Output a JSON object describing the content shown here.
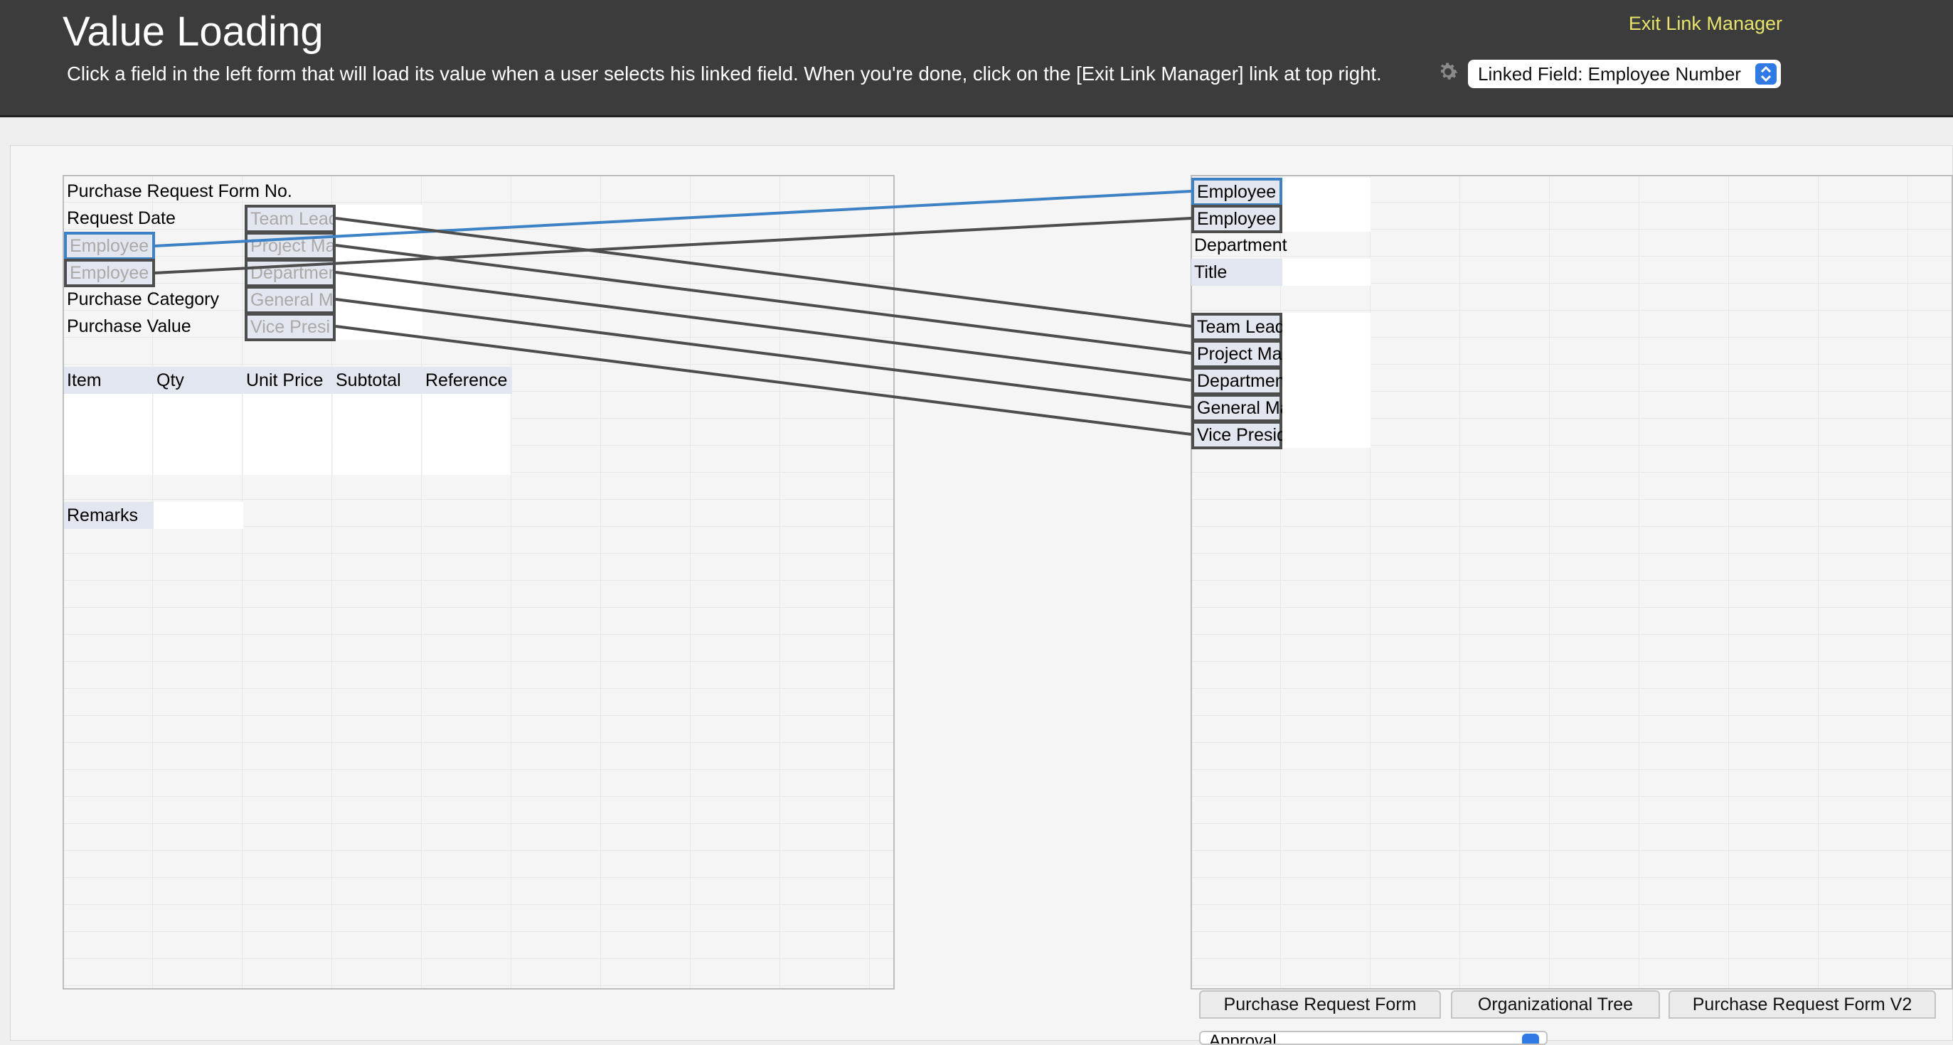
{
  "header": {
    "title": "Value Loading",
    "instructions": "Click a field in the left form that will load its value when a user selects his linked field. When you're done, click on the [Exit Link Manager] link at top right.",
    "exit_link": "Exit Link Manager",
    "settings_icon": "gear-icon",
    "linked_field_select": "Linked Field: Employee Number"
  },
  "left_form": {
    "rows": {
      "form_no": "Purchase Request Form No.",
      "request_date": "Request Date",
      "employee_no_field": "Employee N",
      "employee_name_field": "Employee N",
      "purchase_category": "Purchase Category",
      "purchase_value": "Purchase Value",
      "team_leader_field": "Team Leade",
      "project_manager_field": "Project Ma",
      "department_field": "Department",
      "general_manager_field": "General Ma",
      "vice_president_field": "Vice Presi"
    },
    "table_headers": [
      "Item",
      "Qty",
      "Unit Price",
      "Subtotal",
      "Reference"
    ],
    "remarks": "Remarks"
  },
  "right_form": {
    "rows": {
      "employee_no": "Employee No.",
      "employee": "Employee",
      "department": "Department",
      "title": "Title",
      "team_leader": "Team Leader",
      "project_manager": "Project Manager",
      "department_manager": "Department Manager",
      "general_manager": "General Manager",
      "vice_president": "Vice President"
    }
  },
  "tabs": [
    "Purchase Request Form",
    "Organizational Tree",
    "Purchase Request Form V2"
  ],
  "bottom_select": "Approval",
  "colors": {
    "header_bg": "#3c3c3c",
    "exit_link": "#e6e46a",
    "active_link": "#3d82c4",
    "link_line": "#4d4d4d",
    "label_bg": "#e2e6ee"
  }
}
